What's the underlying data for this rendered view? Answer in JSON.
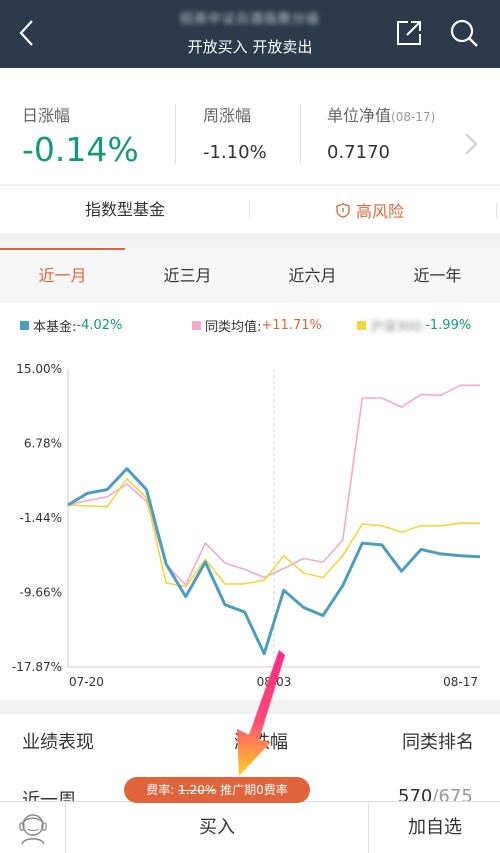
{
  "header": {
    "title": "招商中证白酒指数分级",
    "subtitle": "开放买入 开放卖出"
  },
  "metrics": {
    "daily_label": "日涨幅",
    "daily_value": "-0.14%",
    "weekly_label": "周涨幅",
    "weekly_value": "-1.10%",
    "nav_label": "单位净值",
    "nav_date": "(08-17)",
    "nav_value": "0.7170"
  },
  "tags": {
    "fund_type": "指数型基金",
    "risk": "高风险"
  },
  "period_tabs": [
    "近一月",
    "近三月",
    "近六月",
    "近一年"
  ],
  "legend": [
    {
      "label": "本基金:",
      "value": "-4.02%",
      "color": "#4d9dbf",
      "value_color": "#14997a"
    },
    {
      "label": "同类均值:",
      "value": "+11.71%",
      "color": "#f4a9cf",
      "value_color": "#e0643b"
    },
    {
      "label": "沪深300:",
      "value": "-1.99%",
      "color": "#f5d63a",
      "value_color": "#14997a"
    }
  ],
  "chart_data": {
    "type": "line",
    "x_ticks": [
      "07-20",
      "08-03",
      "08-17"
    ],
    "y_ticks": [
      "15.00%",
      "6.78%",
      "-1.44%",
      "-9.66%",
      "-17.87%"
    ],
    "ylim": [
      -17.87,
      15.0
    ],
    "series": [
      {
        "name": "本基金",
        "color": "#4d9dbf",
        "values": [
          0,
          1.3,
          1.7,
          4.0,
          1.7,
          -6.5,
          -10.1,
          -6.3,
          -11.0,
          -11.8,
          -16.4,
          -9.4,
          -11.3,
          -12.2,
          -8.9,
          -4.2,
          -4.4,
          -7.3,
          -4.9,
          -5.4,
          -5.6,
          -5.7
        ]
      },
      {
        "name": "同类均值",
        "color": "#f4a9cf",
        "values": [
          0,
          0.5,
          0.9,
          2.3,
          0.4,
          -6.6,
          -8.8,
          -4.2,
          -6.4,
          -7.1,
          -8.0,
          -7.0,
          -5.9,
          -6.3,
          -3.9,
          11.8,
          11.8,
          10.8,
          12.2,
          12.1,
          13.2,
          13.2
        ]
      },
      {
        "name": "沪深300",
        "color": "#f5d63a",
        "values": [
          0,
          -0.1,
          -0.2,
          2.9,
          0.8,
          -8.6,
          -9.0,
          -6.0,
          -8.7,
          -8.7,
          -8.3,
          -5.6,
          -7.5,
          -8.0,
          -5.6,
          -2.1,
          -2.3,
          -3.0,
          -2.3,
          -2.3,
          -2.0,
          -2.0
        ]
      }
    ]
  },
  "performance": {
    "col1": "业绩表现",
    "col2": "涨跌幅",
    "col3": "同类排名",
    "row1_label": "近一周",
    "row1_rank": "570",
    "row1_total": "/675"
  },
  "fee": {
    "prefix": "费率:",
    "original": "1.20%",
    "promo": "推广期0费率"
  },
  "bottom": {
    "buy": "买入",
    "watch": "加自选"
  }
}
